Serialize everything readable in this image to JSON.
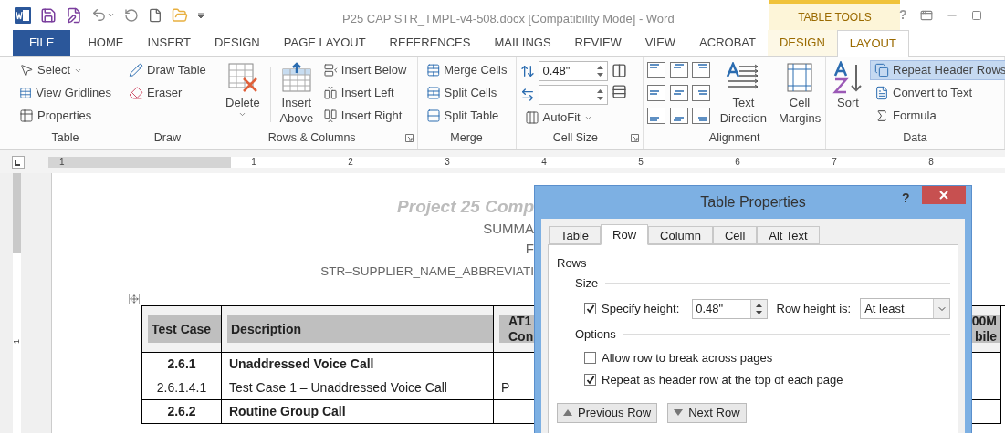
{
  "window": {
    "title": "P25 CAP STR_TMPL-v4-508.docx [Compatibility Mode] - Word",
    "contextual_label": "TABLE TOOLS",
    "help": "?"
  },
  "tabs": [
    {
      "label": "FILE",
      "kind": "file",
      "selected": false
    },
    {
      "label": "HOME",
      "kind": "main",
      "selected": false
    },
    {
      "label": "INSERT",
      "kind": "main",
      "selected": false
    },
    {
      "label": "DESIGN",
      "kind": "main",
      "selected": false
    },
    {
      "label": "PAGE LAYOUT",
      "kind": "main",
      "selected": false
    },
    {
      "label": "REFERENCES",
      "kind": "main",
      "selected": false
    },
    {
      "label": "MAILINGS",
      "kind": "main",
      "selected": false
    },
    {
      "label": "REVIEW",
      "kind": "main",
      "selected": false
    },
    {
      "label": "VIEW",
      "kind": "main",
      "selected": false
    },
    {
      "label": "ACROBAT",
      "kind": "main",
      "selected": false
    },
    {
      "label": "DESIGN",
      "kind": "contextual",
      "selected": false
    },
    {
      "label": "LAYOUT",
      "kind": "contextual",
      "selected": true
    }
  ],
  "ribbon": {
    "groups": [
      {
        "kind": "list",
        "label": "Table",
        "items": [
          {
            "label": "Select",
            "dropdown": true
          },
          {
            "label": "View Gridlines"
          },
          {
            "label": "Properties"
          }
        ]
      },
      {
        "kind": "draw",
        "label": "Draw",
        "items": [
          {
            "label": "Draw Table"
          },
          {
            "label": "Eraser"
          }
        ]
      },
      {
        "kind": "rows",
        "label": "Rows & Columns",
        "launcher": true,
        "large": [
          {
            "label": "Delete",
            "dropdown": true
          },
          {
            "label": "Insert Above"
          }
        ],
        "items": [
          {
            "label": "Insert Below"
          },
          {
            "label": "Insert Left"
          },
          {
            "label": "Insert Right"
          }
        ]
      },
      {
        "kind": "merge",
        "label": "Merge",
        "items": [
          {
            "label": "Merge Cells"
          },
          {
            "label": "Split Cells"
          },
          {
            "label": "Split Table"
          }
        ]
      },
      {
        "kind": "cellsize",
        "label": "Cell Size",
        "launcher": true,
        "spinners": [
          {
            "kind": "height",
            "value": "0.48\""
          },
          {
            "kind": "width"
          }
        ],
        "items": [
          {
            "label": "AutoFit",
            "dropdown": true
          }
        ]
      },
      {
        "kind": "alignment",
        "label": "Alignment",
        "large": [
          {
            "label": "Text Direction"
          },
          {
            "label": "Cell Margins"
          }
        ]
      },
      {
        "kind": "data",
        "label": "Data",
        "large": [
          {
            "label": "Sort"
          }
        ],
        "items": [
          {
            "label": "Repeat Header Rows",
            "on": true
          },
          {
            "label": "Convert to Text",
            "on": false
          },
          {
            "label": "Formula",
            "on": false
          }
        ]
      }
    ]
  },
  "ruler": {
    "numbers": [
      "1",
      "1",
      "2",
      "3",
      "4",
      "5",
      "6",
      "7",
      "8"
    ]
  },
  "vertical_ruler": {
    "numbers": [
      "1"
    ]
  },
  "document": {
    "heading": [
      {
        "kind": "title",
        "text": "Project 25 Comp"
      },
      {
        "kind": "subtitle",
        "text": "SUMMA"
      },
      {
        "kind": "subtitle",
        "text": "F"
      },
      {
        "kind": "small",
        "text": "STR–SUPPLIER_NAME_ABBREVIATI"
      }
    ],
    "table": {
      "columns": [
        {
          "lines": [
            "Test Case"
          ]
        },
        {
          "lines": [
            "Description"
          ]
        },
        {
          "lines": [
            "AT1",
            "Con"
          ]
        },
        {
          "lines": [
            "00M",
            "bile"
          ]
        }
      ],
      "rows": [
        {
          "kind": "section",
          "test_case": "2.6.1",
          "description": "Unaddressed Voice Call"
        },
        {
          "kind": "case",
          "test_case": "2.6.1.4.1",
          "description": "Test Case 1 – Unaddressed Voice Call",
          "column_3": "P"
        },
        {
          "kind": "section",
          "test_case": "2.6.2",
          "description": "Routine Group Call"
        }
      ]
    }
  },
  "dialog": {
    "title": "Table Properties",
    "help": "?",
    "tabs": [
      {
        "label": "Table",
        "selected": false
      },
      {
        "label": "Row",
        "selected": true
      },
      {
        "label": "Column",
        "selected": false
      },
      {
        "label": "Cell",
        "selected": false
      },
      {
        "label": "Alt Text",
        "selected": false
      }
    ],
    "section": "Rows",
    "size_label": "Size",
    "specify_height": {
      "label": "Specify height:",
      "checked": true,
      "value": "0.48\""
    },
    "row_height_is": {
      "label": "Row height is:",
      "value": "At least"
    },
    "options_label": "Options",
    "options": [
      {
        "label": "Allow row to break across pages",
        "checked": false
      },
      {
        "label": "Repeat as header row at the top of each page",
        "checked": true
      }
    ],
    "buttons": [
      {
        "label": "Previous Row",
        "kind": "previous"
      },
      {
        "label": "Next Row",
        "kind": "next"
      }
    ]
  }
}
